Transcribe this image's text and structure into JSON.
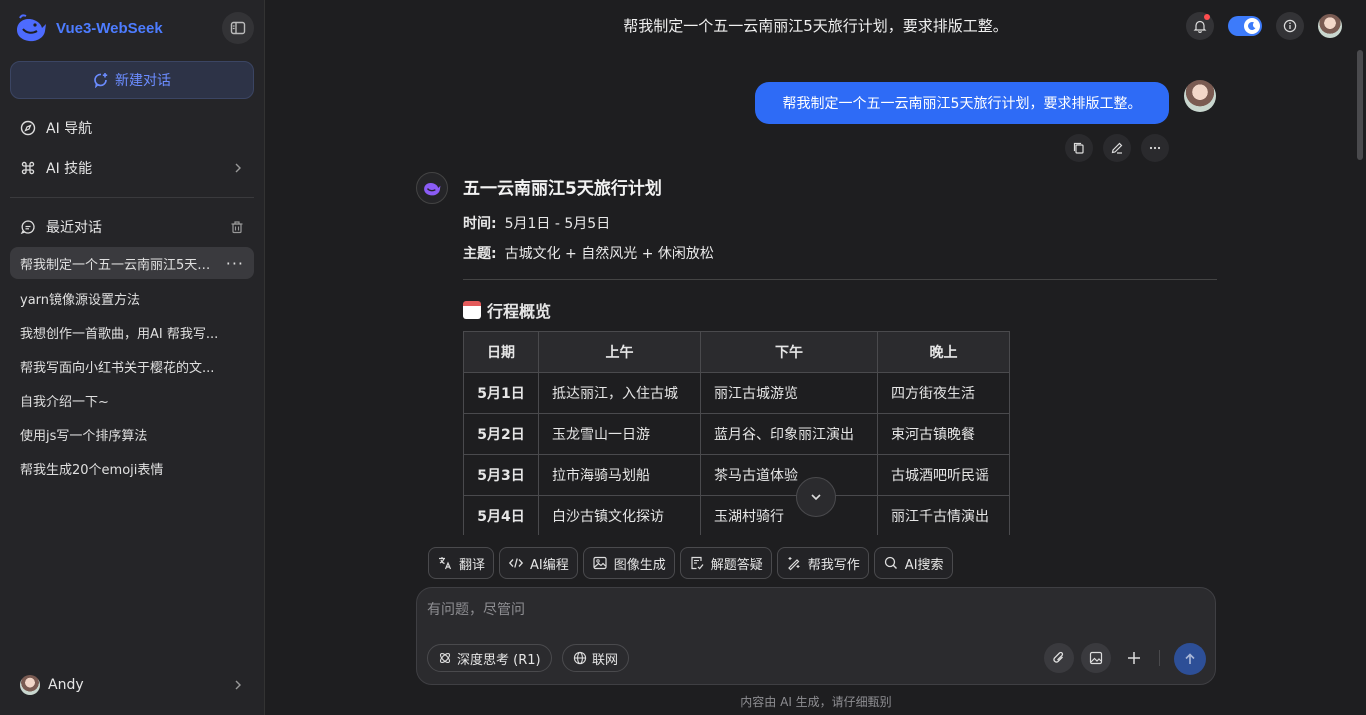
{
  "sidebar": {
    "brand": "Vue3-WebSeek",
    "new_chat": "新建对话",
    "nav": [
      {
        "label": "AI 导航"
      },
      {
        "label": "AI 技能"
      }
    ],
    "recent_title": "最近对话",
    "history": [
      "帮我制定一个五一云南丽江5天旅行计划，要求排版工整。",
      "yarn镜像源设置方法",
      "我想创作一首歌曲，用AI 帮我写...",
      "帮我写面向小红书关于樱花的文...",
      "自我介绍一下~",
      "使用js写一个排序算法",
      "帮我生成20个emoji表情"
    ],
    "user_name": "Andy"
  },
  "header": {
    "title": "帮我制定一个五一云南丽江5天旅行计划，要求排版工整。"
  },
  "conversation": {
    "user_message": "帮我制定一个五一云南丽江5天旅行计划，要求排版工整。",
    "answer": {
      "title": "五一云南丽江5天旅行计划",
      "time_label": "时间:",
      "time_value": "5月1日 - 5月5日",
      "theme_label": "主题:",
      "theme_value": "古城文化 + 自然风光 + 休闲放松",
      "overview_title": "行程概览",
      "table": {
        "headers": [
          "日期",
          "上午",
          "下午",
          "晚上"
        ],
        "rows": [
          [
            "5月1日",
            "抵达丽江，入住古城",
            "丽江古城游览",
            "四方街夜生活"
          ],
          [
            "5月2日",
            "玉龙雪山一日游",
            "蓝月谷、印象丽江演出",
            "束河古镇晚餐"
          ],
          [
            "5月3日",
            "拉市海骑马划船",
            "茶马古道体验",
            "古城酒吧听民谣"
          ],
          [
            "5月4日",
            "白沙古镇文化探访",
            "玉湖村骑行",
            "丽江千古情演出"
          ]
        ]
      }
    }
  },
  "quick_actions": [
    "翻译",
    "AI编程",
    "图像生成",
    "解题答疑",
    "帮我写作",
    "AI搜索"
  ],
  "composer": {
    "placeholder": "有问题，尽管问",
    "deep_think": "深度思考 (R1)",
    "web_search": "联网"
  },
  "footer_note": "内容由 AI 生成，请仔细甄别",
  "colors": {
    "accent": "#2e6bf6",
    "brand": "#4d7cff",
    "background": "#1e1e20",
    "sidebar": "#252528"
  }
}
